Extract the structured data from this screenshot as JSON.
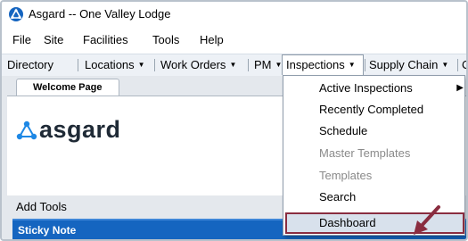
{
  "window": {
    "title": "Asgard -- One Valley Lodge"
  },
  "menubar": {
    "items": [
      "File",
      "Site",
      "Facilities",
      "Tools",
      "Help"
    ]
  },
  "toolbar": {
    "items": [
      "Directory",
      "Locations",
      "Work Orders",
      "PM",
      "Inspections",
      "Supply Chain",
      "C"
    ],
    "caret": "▼"
  },
  "tabs": {
    "welcome": "Welcome Page"
  },
  "logo": {
    "text": "asgard"
  },
  "add_tools": {
    "label": "Add Tools"
  },
  "sticky_note": {
    "label": "Sticky Note"
  },
  "inspections_menu": {
    "items": [
      {
        "label": "Active Inspections",
        "submenu_arrow": "▶",
        "enabled": true
      },
      {
        "label": "Recently Completed",
        "enabled": true
      },
      {
        "label": "Schedule",
        "enabled": true
      },
      {
        "label": "Master Templates",
        "enabled": false
      },
      {
        "label": "Templates",
        "enabled": false
      },
      {
        "label": "Search",
        "enabled": true
      },
      {
        "label": "Dashboard",
        "enabled": true,
        "highlighted": true
      }
    ]
  },
  "colors": {
    "accent": "#1565c0",
    "highlight_border": "#8a2d40",
    "arrow": "#8a2d40"
  }
}
